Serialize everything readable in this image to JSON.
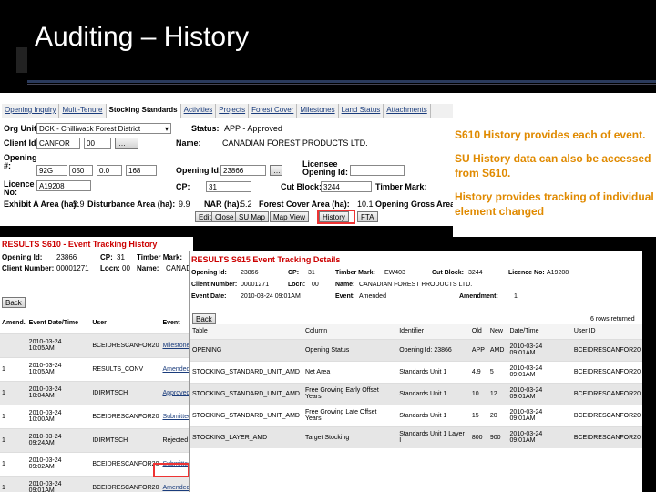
{
  "slide": {
    "title": "Auditing – History"
  },
  "s610": {
    "tabs": [
      "Opening Inquiry",
      "Multi-Tenure",
      "Stocking Standards",
      "Activities",
      "Projects",
      "Forest Cover",
      "Milestones",
      "Land Status",
      "Attachments"
    ],
    "active_tab": "Stocking Standards",
    "org_unit_label": "Org Unit:",
    "org_unit_value": "DCK - Chilliwack Forest District",
    "status_label": "Status:",
    "status_value": "APP - Approved",
    "client_label": "Client Id:",
    "client_value": "CANFOR",
    "client_loc": "00",
    "name_label": "Name:",
    "name_value": "CANADIAN FOREST PRODUCTS LTD.",
    "opening_label": "Opening #:",
    "opening_map": "92G",
    "opening_a": "050",
    "opening_b": "0.0",
    "opening_c": "168",
    "opening_id_label": "Opening Id:",
    "opening_id_value": "23866",
    "licensee_label": "Licensee Opening Id:",
    "licence_label": "Licence No:",
    "licence_value": "A19208",
    "cp_label": "CP:",
    "cp_value": "31",
    "cut_block_label": "Cut Block:",
    "cut_block_value": "3244",
    "timber_mark_label": "Timber Mark:",
    "exhibit_label": "Exhibit A Area (ha):",
    "exhibit_value": "9.9",
    "disturbance_label": "Disturbance Area (ha):",
    "disturbance_value": "9.9",
    "nar_label": "NAR (ha):",
    "nar_value": "5.2",
    "forest_cover_label": "Forest Cover Area (ha):",
    "forest_cover_value": "10.1",
    "gross_label": "Opening Gross Area",
    "buttons": [
      "Edit",
      "Close",
      "SU Map",
      "Map View",
      "History",
      "FTA"
    ]
  },
  "notes": [
    "S610 History provides each of event.",
    "SU History data can also be accessed from S610.",
    "History provides tracking of individual element changed"
  ],
  "s610_history": {
    "heading": "RESULTS S610 - Event Tracking History",
    "opening_id_label": "Opening Id:",
    "opening_id_value": "23866",
    "cp_label": "CP:",
    "cp_value": "31",
    "timber_mark_label": "Timber Mark:",
    "client_num_label": "Client Number:",
    "client_num_value": "00001271",
    "locn_label": "Locn:",
    "locn_value": "00",
    "name_label": "Name:",
    "name_value": "CANAD",
    "back_label": "Back",
    "columns": [
      "Amend.",
      "Event Date/Time",
      "User",
      "Event"
    ],
    "rows": [
      {
        "amend": "",
        "date": "2010-03-24 10:05AM",
        "user": "BCEIDRESCANFOR20",
        "event": "Milestone",
        "link": true
      },
      {
        "amend": "1",
        "date": "2010-03-24 10:05AM",
        "user": "RESULTS_CONV",
        "event": "Amended",
        "link": true
      },
      {
        "amend": "1",
        "date": "2010-03-24 10:04AM",
        "user": "IDIRMTSCH",
        "event": "Approved",
        "link": true
      },
      {
        "amend": "1",
        "date": "2010-03-24 10:00AM",
        "user": "BCEIDRESCANFOR20",
        "event": "Submitted",
        "link": true
      },
      {
        "amend": "1",
        "date": "2010-03-24 09:24AM",
        "user": "IDIRMTSCH",
        "event": "Rejected",
        "link": false
      },
      {
        "amend": "1",
        "date": "2010-03-24 09:02AM",
        "user": "BCEIDRESCANFOR20",
        "event": "Submitted",
        "link": true
      },
      {
        "amend": "1",
        "date": "2010-03-24 09:01AM",
        "user": "BCEIDRESCANFOR20",
        "event": "Amended",
        "link": true
      }
    ]
  },
  "s615": {
    "heading": "RESULTS S615 Event Tracking Details",
    "opening_id_label": "Opening Id:",
    "opening_id_value": "23866",
    "cp_label": "CP:",
    "cp_value": "31",
    "timber_mark_label": "Timber Mark:",
    "timber_mark_value": "EW403",
    "cut_block_label": "Cut Block:",
    "cut_block_value": "3244",
    "licence_label": "Licence No:",
    "licence_value": "A19208",
    "client_num_label": "Client Number:",
    "client_num_value": "00001271",
    "locn_label": "Locn:",
    "locn_value": "00",
    "name_label": "Name:",
    "name_value": "CANADIAN FOREST PRODUCTS LTD.",
    "event_date_label": "Event Date:",
    "event_date_value": "2010-03-24 09:01AM",
    "event_label": "Event:",
    "event_value": "Amended",
    "amendment_label": "Amendment:",
    "amendment_value": "1",
    "back_label": "Back",
    "rows_returned": "6 rows returned",
    "columns": [
      "Table",
      "Column",
      "Identifier",
      "Old",
      "New",
      "Date/Time",
      "User ID"
    ],
    "rows": [
      {
        "table": "OPENING",
        "column": "Opening Status",
        "identifier": "Opening Id: 23866",
        "old": "APP",
        "new": "AMD",
        "datetime": "2010-03-24 09:01AM",
        "user": "BCEIDRESCANFOR20"
      },
      {
        "table": "STOCKING_STANDARD_UNIT_AMD",
        "column": "Net Area",
        "identifier": "Standards Unit 1",
        "old": "4.9",
        "new": "5",
        "datetime": "2010-03-24 09:01AM",
        "user": "BCEIDRESCANFOR20"
      },
      {
        "table": "STOCKING_STANDARD_UNIT_AMD",
        "column": "Free Growing Early Offset Years",
        "identifier": "Standards Unit 1",
        "old": "10",
        "new": "12",
        "datetime": "2010-03-24 09:01AM",
        "user": "BCEIDRESCANFOR20"
      },
      {
        "table": "STOCKING_STANDARD_UNIT_AMD",
        "column": "Free Growing Late Offset Years",
        "identifier": "Standards Unit 1",
        "old": "15",
        "new": "20",
        "datetime": "2010-03-24 09:01AM",
        "user": "BCEIDRESCANFOR20"
      },
      {
        "table": "STOCKING_LAYER_AMD",
        "column": "Target Stocking",
        "identifier": "Standards Unit 1 Layer I",
        "old": "800",
        "new": "900",
        "datetime": "2010-03-24 09:01AM",
        "user": "BCEIDRESCANFOR20"
      }
    ]
  }
}
